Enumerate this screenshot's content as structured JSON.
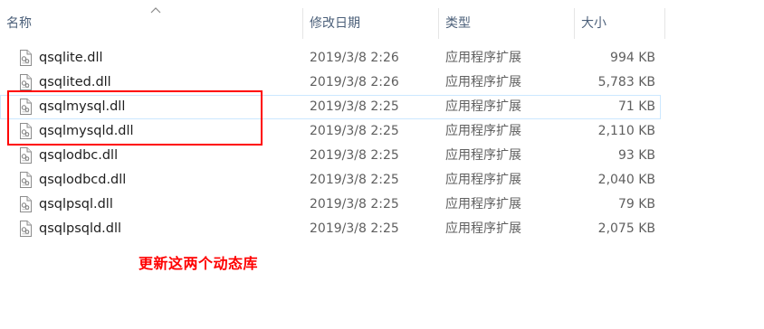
{
  "columns": {
    "name": "名称",
    "date": "修改日期",
    "type": "类型",
    "size": "大小"
  },
  "sort_indicator": "chevron-up-icon",
  "files": [
    {
      "name": "qsqlite.dll",
      "date": "2019/3/8 2:26",
      "type": "应用程序扩展",
      "size": "994 KB"
    },
    {
      "name": "qsqlited.dll",
      "date": "2019/3/8 2:26",
      "type": "应用程序扩展",
      "size": "5,783 KB"
    },
    {
      "name": "qsqlmysql.dll",
      "date": "2019/3/8 2:25",
      "type": "应用程序扩展",
      "size": "71 KB"
    },
    {
      "name": "qsqlmysqld.dll",
      "date": "2019/3/8 2:25",
      "type": "应用程序扩展",
      "size": "2,110 KB"
    },
    {
      "name": "qsqlodbc.dll",
      "date": "2019/3/8 2:25",
      "type": "应用程序扩展",
      "size": "93 KB"
    },
    {
      "name": "qsqlodbcd.dll",
      "date": "2019/3/8 2:25",
      "type": "应用程序扩展",
      "size": "2,040 KB"
    },
    {
      "name": "qsqlpsql.dll",
      "date": "2019/3/8 2:25",
      "type": "应用程序扩展",
      "size": "79 KB"
    },
    {
      "name": "qsqlpsqld.dll",
      "date": "2019/3/8 2:25",
      "type": "应用程序扩展",
      "size": "2,075 KB"
    }
  ],
  "hovered_row": 2,
  "annotation": {
    "text": "更新这两个动态库",
    "color": "#ff0000"
  },
  "colors": {
    "header_text": "#4c607a",
    "hover_border": "#cce8ff",
    "detail_text": "#5f5f5f"
  }
}
